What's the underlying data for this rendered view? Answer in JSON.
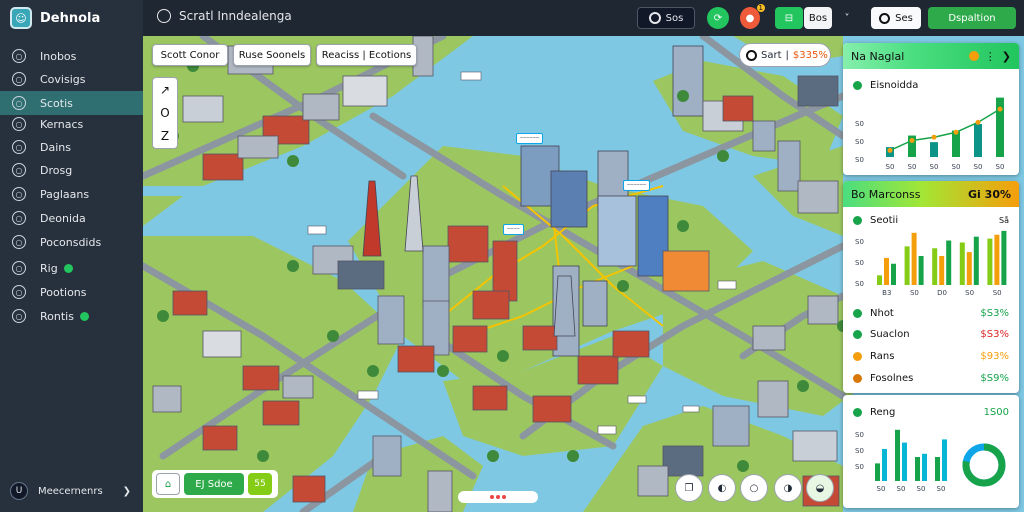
{
  "app": {
    "name": "Dehnola"
  },
  "sidebar": {
    "items": [
      {
        "label": "Inobos",
        "active": false,
        "badge": false
      },
      {
        "label": "Covisigs",
        "active": false,
        "badge": false
      },
      {
        "label": "Scotis",
        "active": true,
        "badge": false
      },
      {
        "label": "Kernacs",
        "active": false,
        "badge": false
      },
      {
        "label": "Dains",
        "active": false,
        "badge": false
      },
      {
        "label": "Drosg",
        "active": false,
        "badge": false
      },
      {
        "label": "Paglaans",
        "active": false,
        "badge": false
      },
      {
        "label": "Deonida",
        "active": false,
        "badge": false
      },
      {
        "label": "Poconsdids",
        "active": false,
        "badge": false
      },
      {
        "label": "Rig",
        "active": false,
        "badge": true
      },
      {
        "label": "Pootions",
        "active": false,
        "badge": false
      },
      {
        "label": "Rontis",
        "active": false,
        "badge": true
      }
    ],
    "footer": {
      "avatar": "U",
      "label": "Meecernenrs"
    }
  },
  "topbar": {
    "title": "Scratl Inndealenga",
    "zoom": "Sos",
    "layer_a": "⊟",
    "layer_b": "Bos",
    "more": "˅",
    "search": "Ses",
    "action": "Dspaltion"
  },
  "map": {
    "chips": [
      "Scott Conor",
      "Ruse Soonels",
      "Reaciss | Ecotions"
    ],
    "tools": [
      "↗",
      "O",
      "Z"
    ],
    "status": {
      "label": "Sart",
      "divider": "|",
      "value": "$335%"
    },
    "labels": [
      "‒‒‒‒‒‒",
      "‒‒‒‒‒‒",
      "‒‒‒‒"
    ],
    "bottom": {
      "b1": "⌂",
      "b2": "EJ Sdoe",
      "b3": "55"
    },
    "round_buttons": [
      "❐",
      "◐",
      "○",
      "◑",
      "◒"
    ]
  },
  "panels": {
    "p1": {
      "title": "Na Naglal",
      "legend": "Eisnoidda",
      "y_ticks": [
        "S0",
        "S0",
        "S0"
      ],
      "chart_data": {
        "type": "bar",
        "categories": [
          "S0",
          "S0",
          "S0",
          "S0",
          "S0",
          "S0"
        ],
        "series": [
          {
            "values": [
              8,
              20,
              24,
              30,
              42,
              58
            ]
          },
          {
            "values": [
              12,
              26,
              18,
              32,
              40,
              72
            ]
          }
        ],
        "ylim": [
          0,
          80
        ]
      }
    },
    "p2": {
      "title": "Bo Marconss",
      "amount": "Gi 30%",
      "legend": "Seotii",
      "right_label": "Så",
      "y_ticks": [
        "S0",
        "S0",
        "S0"
      ],
      "chart_data": {
        "type": "bar",
        "categories": [
          "B3",
          "S0",
          "D0",
          "S0",
          "S0"
        ],
        "series": [
          {
            "color": "#84cc16",
            "values": [
              10,
              40,
              38,
              44,
              48
            ]
          },
          {
            "color": "#f59e0b",
            "values": [
              28,
              54,
              30,
              34,
              52
            ]
          },
          {
            "color": "#16a34a",
            "values": [
              22,
              30,
              46,
              50,
              56
            ]
          }
        ],
        "ylim": [
          0,
          60
        ]
      },
      "rows": [
        {
          "label": "Nhot",
          "value": "$S3%",
          "color": "#16a34a",
          "dot": "gdot"
        },
        {
          "label": "Suaclon",
          "value": "$S3%",
          "color": "#dc2626",
          "dot": "gdot"
        },
        {
          "label": "Rans",
          "value": "$93%",
          "color": "#f59e0b",
          "dot": "ydot"
        },
        {
          "label": "Fosolnes",
          "value": "$S9%",
          "color": "#16a34a",
          "dot": "odot2"
        }
      ]
    },
    "p3": {
      "legend": "Reng",
      "value": "1S00",
      "y_ticks": [
        "S0",
        "S0",
        "S0"
      ],
      "chart_data": {
        "type": "bar",
        "categories": [
          "S0",
          "S0",
          "S0",
          "S0"
        ],
        "series": [
          {
            "color": "#16a34a",
            "values": [
              22,
              64,
              30,
              30
            ]
          },
          {
            "color": "#06b6d4",
            "values": [
              40,
              48,
              34,
              52
            ]
          }
        ],
        "ylim": [
          0,
          70
        ]
      },
      "donut": {
        "value": 0.78,
        "colors": [
          "#16a34a",
          "#0ea5e9"
        ]
      }
    }
  }
}
